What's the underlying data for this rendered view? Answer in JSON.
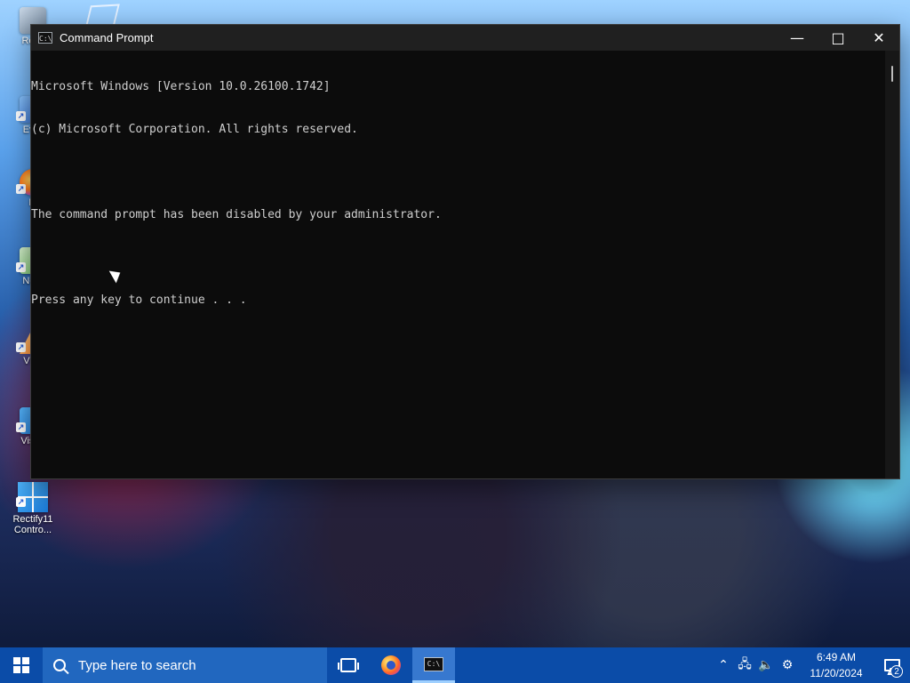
{
  "desktop": {
    "icons": [
      {
        "label": "Recy"
      },
      {
        "label": "Ever"
      },
      {
        "label": "Fi"
      },
      {
        "label": "Note"
      },
      {
        "label": "VLC"
      },
      {
        "label": "Visua"
      },
      {
        "label": "Rectify11 Contro..."
      }
    ]
  },
  "window": {
    "title": "Command Prompt",
    "app_icon": "C:\\",
    "controls": {
      "minimize": "—",
      "maximize": "□",
      "close": "✕"
    }
  },
  "console": {
    "lines": [
      "Microsoft Windows [Version 10.0.26100.1742]",
      "(c) Microsoft Corporation. All rights reserved.",
      "",
      "The command prompt has been disabled by your administrator.",
      "",
      "Press any key to continue . . ."
    ]
  },
  "taskbar": {
    "search_placeholder": "Type here to search",
    "apps": [
      {
        "name": "task-view-icon"
      },
      {
        "name": "firefox-icon"
      },
      {
        "name": "command-prompt-icon",
        "label": "C:\\"
      }
    ],
    "tray": {
      "chevron": "⌃",
      "network": "🖧",
      "volume": "🔈",
      "settings": "⚙",
      "time": "6:49 AM",
      "date": "11/20/2024",
      "notification_count": "2"
    }
  },
  "colors": {
    "console_background": "#0c0c0c",
    "console_text": "#cfcfcf",
    "titlebar": "#202020",
    "taskbar": "#0b4ca8",
    "active_taskbar_item": "#3778cf"
  }
}
